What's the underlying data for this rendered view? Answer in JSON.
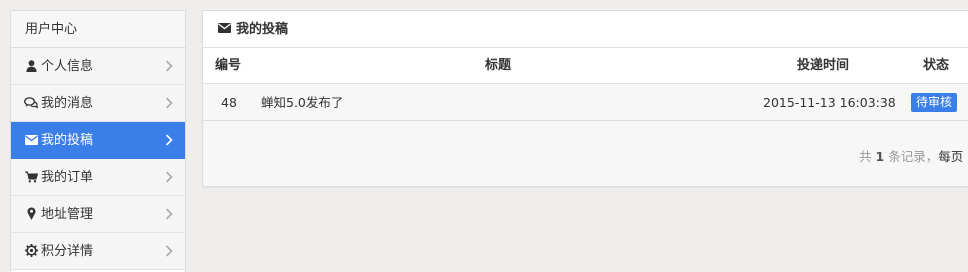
{
  "sidebar": {
    "header": "用户中心",
    "items": [
      {
        "label": "个人信息",
        "icon": "user-icon",
        "active": false
      },
      {
        "label": "我的消息",
        "icon": "comments-icon",
        "active": false
      },
      {
        "label": "我的投稿",
        "icon": "envelope-icon",
        "active": true
      },
      {
        "label": "我的订单",
        "icon": "cart-icon",
        "active": false
      },
      {
        "label": "地址管理",
        "icon": "map-marker-icon",
        "active": false
      },
      {
        "label": "积分详情",
        "icon": "gear-icon",
        "active": false
      }
    ]
  },
  "panel": {
    "title": "我的投稿",
    "columns": {
      "id": "编号",
      "title": "标题",
      "time": "投递时间",
      "status": "状态"
    },
    "rows": [
      {
        "id": "48",
        "title": "蝉知5.0发布了",
        "time": "2015-11-13 16:03:38",
        "status": "待审核"
      }
    ],
    "pager": {
      "prefix": "共",
      "count": "1",
      "suffix": "条记录，",
      "per_page": "每页"
    }
  },
  "colors": {
    "accent": "#3a7ee8",
    "background": "#efeeec"
  }
}
